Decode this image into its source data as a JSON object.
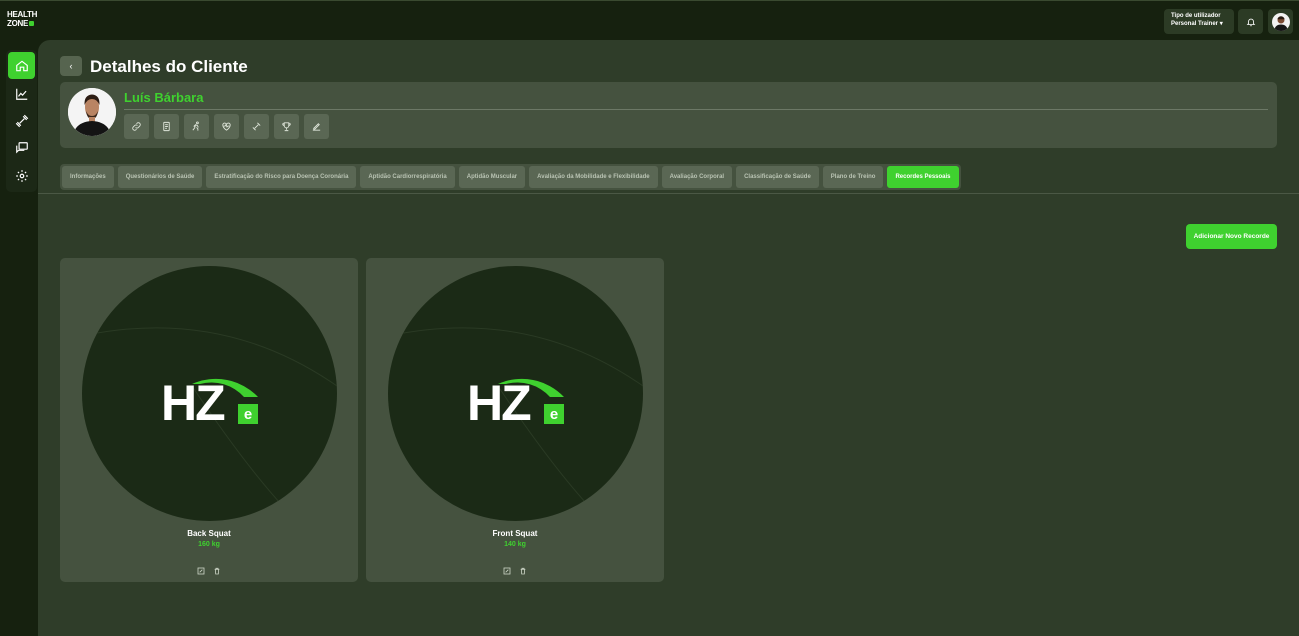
{
  "app": {
    "logo_line1": "HEALTH",
    "logo_line2": "ZONE",
    "accent_color": "#3fd12f"
  },
  "header": {
    "user_type_label": "Tipo de utilizador",
    "user_type_value": "Personal Trainer",
    "user_type_caret": "▾",
    "bell_icon": "bell-icon",
    "avatar_icon": "user-avatar"
  },
  "sidebar": {
    "items": [
      {
        "name": "home",
        "icon": "home-icon",
        "active": true
      },
      {
        "name": "stats",
        "icon": "chart-icon",
        "active": false
      },
      {
        "name": "workouts",
        "icon": "dumbbell-icon",
        "active": false
      },
      {
        "name": "messages",
        "icon": "chat-icon",
        "active": false
      },
      {
        "name": "settings",
        "icon": "gear-icon",
        "active": false
      }
    ]
  },
  "page": {
    "back_label": "‹",
    "title": "Detalhes do Cliente"
  },
  "client": {
    "name": "Luís Bárbara",
    "actions": [
      "link-icon",
      "document-icon",
      "running-icon",
      "heart-icon",
      "dumbbell-icon",
      "trophy-icon",
      "edit-icon"
    ]
  },
  "tabs": [
    {
      "label": "Informações",
      "active": false
    },
    {
      "label": "Questionários de Saúde",
      "active": false
    },
    {
      "label": "Estratificação do Risco para Doença Coronária",
      "active": false
    },
    {
      "label": "Aptidão Cardiorrespiratória",
      "active": false
    },
    {
      "label": "Aptidão Muscular",
      "active": false
    },
    {
      "label": "Avaliação da Mobilidade e Flexibilidade",
      "active": false
    },
    {
      "label": "Avaliação Corporal",
      "active": false
    },
    {
      "label": "Classificação de Saúde",
      "active": false
    },
    {
      "label": "Plano de Treino",
      "active": false
    },
    {
      "label": "Recordes Pessoais",
      "active": true
    }
  ],
  "records": {
    "add_label": "Adicionar Novo Recorde",
    "logo_text": "HZ",
    "logo_badge": "e",
    "items": [
      {
        "name": "Back Squat",
        "value": "160 kg"
      },
      {
        "name": "Front Squat",
        "value": "140 kg"
      }
    ]
  }
}
